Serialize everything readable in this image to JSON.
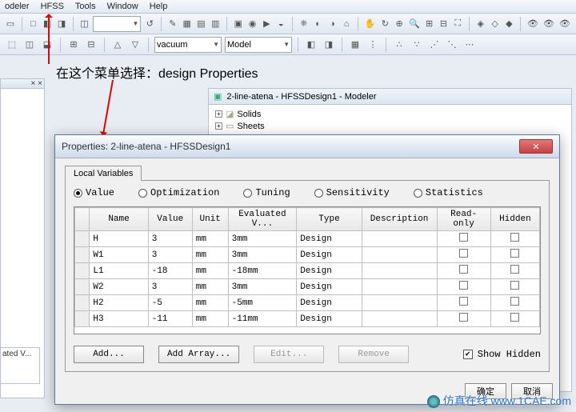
{
  "menu": {
    "items": [
      "odeler",
      "HFSS",
      "Tools",
      "Window",
      "Help"
    ]
  },
  "toolbar2": {
    "combo1": "vacuum",
    "combo2": "Model"
  },
  "annotation": "在这个菜单选择：design Properties",
  "modeler": {
    "title": "2-line-atena - HFSSDesign1 - Modeler",
    "tree": [
      "Solids",
      "Sheets"
    ]
  },
  "dialog": {
    "title": "Properties: 2-line-atena - HFSSDesign1",
    "tab": "Local Variables",
    "radios": [
      "Value",
      "Optimization",
      "Tuning",
      "Sensitivity",
      "Statistics"
    ],
    "selectedRadio": 0,
    "columns": [
      "Name",
      "Value",
      "Unit",
      "Evaluated V...",
      "Type",
      "Description",
      "Read-only",
      "Hidden"
    ],
    "rows": [
      {
        "name": "H",
        "value": "3",
        "unit": "mm",
        "eval": "3mm",
        "type": "Design",
        "desc": ""
      },
      {
        "name": "W1",
        "value": "3",
        "unit": "mm",
        "eval": "3mm",
        "type": "Design",
        "desc": ""
      },
      {
        "name": "L1",
        "value": "-18",
        "unit": "mm",
        "eval": "-18mm",
        "type": "Design",
        "desc": ""
      },
      {
        "name": "W2",
        "value": "3",
        "unit": "mm",
        "eval": "3mm",
        "type": "Design",
        "desc": ""
      },
      {
        "name": "H2",
        "value": "-5",
        "unit": "mm",
        "eval": "-5mm",
        "type": "Design",
        "desc": ""
      },
      {
        "name": "H3",
        "value": "-11",
        "unit": "mm",
        "eval": "-11mm",
        "type": "Design",
        "desc": ""
      }
    ],
    "buttons": {
      "add": "Add...",
      "addArray": "Add Array...",
      "edit": "Edit...",
      "remove": "Remove"
    },
    "showHidden": "Show Hidden",
    "footer": {
      "ok": "确定",
      "cancel": "取消"
    }
  },
  "stub": {
    "ated": "ated V..."
  },
  "watermark": "仿真在线 www.1CAE.com"
}
